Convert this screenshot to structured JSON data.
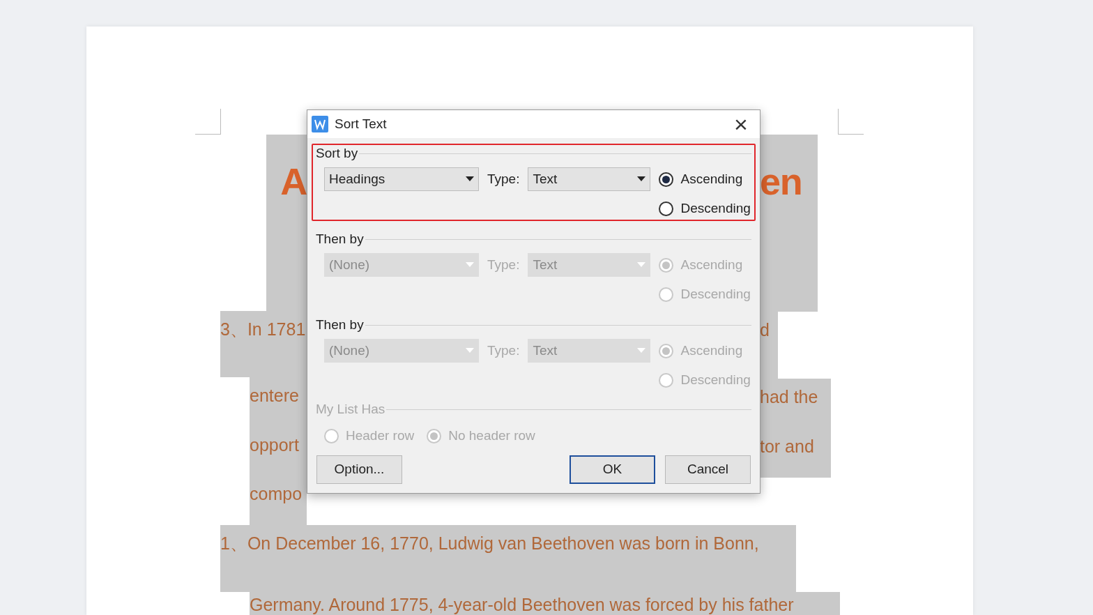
{
  "document": {
    "left_fragments": [
      {
        "kind": "title",
        "text": "A"
      },
      {
        "kind": "item",
        "text": "3、In 1781"
      },
      {
        "kind": "line",
        "text": "entere"
      },
      {
        "kind": "line",
        "text": "opport"
      },
      {
        "kind": "line",
        "text": "compo"
      }
    ],
    "right_fragments": [
      {
        "kind": "title",
        "text": "en"
      },
      {
        "kind": "item",
        "text": "d"
      },
      {
        "kind": "line",
        "text": "had the"
      },
      {
        "kind": "line",
        "text": "tor and"
      }
    ],
    "lines": [
      {
        "kind": "item",
        "text": "1、On December 16, 1770, Ludwig van Beethoven was born in Bonn,"
      },
      {
        "kind": "line",
        "text": "Germany. Around 1775, 4-year-old Beethoven was forced by his father"
      }
    ]
  },
  "dialog": {
    "title": "Sort Text",
    "close": "×",
    "groups": [
      {
        "label": "Sort by",
        "highlighted": true,
        "disabled": false,
        "field": "Headings",
        "type_label": "Type:",
        "type_value": "Text",
        "options": [
          {
            "label": "Ascending",
            "selected": true
          },
          {
            "label": "Descending",
            "selected": false
          }
        ]
      },
      {
        "label": "Then by",
        "highlighted": false,
        "disabled": true,
        "field": "(None)",
        "type_label": "Type:",
        "type_value": "Text",
        "options": [
          {
            "label": "Ascending",
            "selected": true
          },
          {
            "label": "Descending",
            "selected": false
          }
        ]
      },
      {
        "label": "Then by",
        "highlighted": false,
        "disabled": true,
        "field": "(None)",
        "type_label": "Type:",
        "type_value": "Text",
        "options": [
          {
            "label": "Ascending",
            "selected": true
          },
          {
            "label": "Descending",
            "selected": false
          }
        ]
      }
    ],
    "list_has": {
      "label": "My List Has",
      "disabled": true,
      "options": [
        {
          "label": "Header row",
          "selected": false
        },
        {
          "label": "No header row",
          "selected": true
        }
      ]
    },
    "buttons": [
      {
        "label": "Option...",
        "default": false
      },
      {
        "label": "OK",
        "default": true
      },
      {
        "label": "Cancel",
        "default": false
      }
    ]
  }
}
